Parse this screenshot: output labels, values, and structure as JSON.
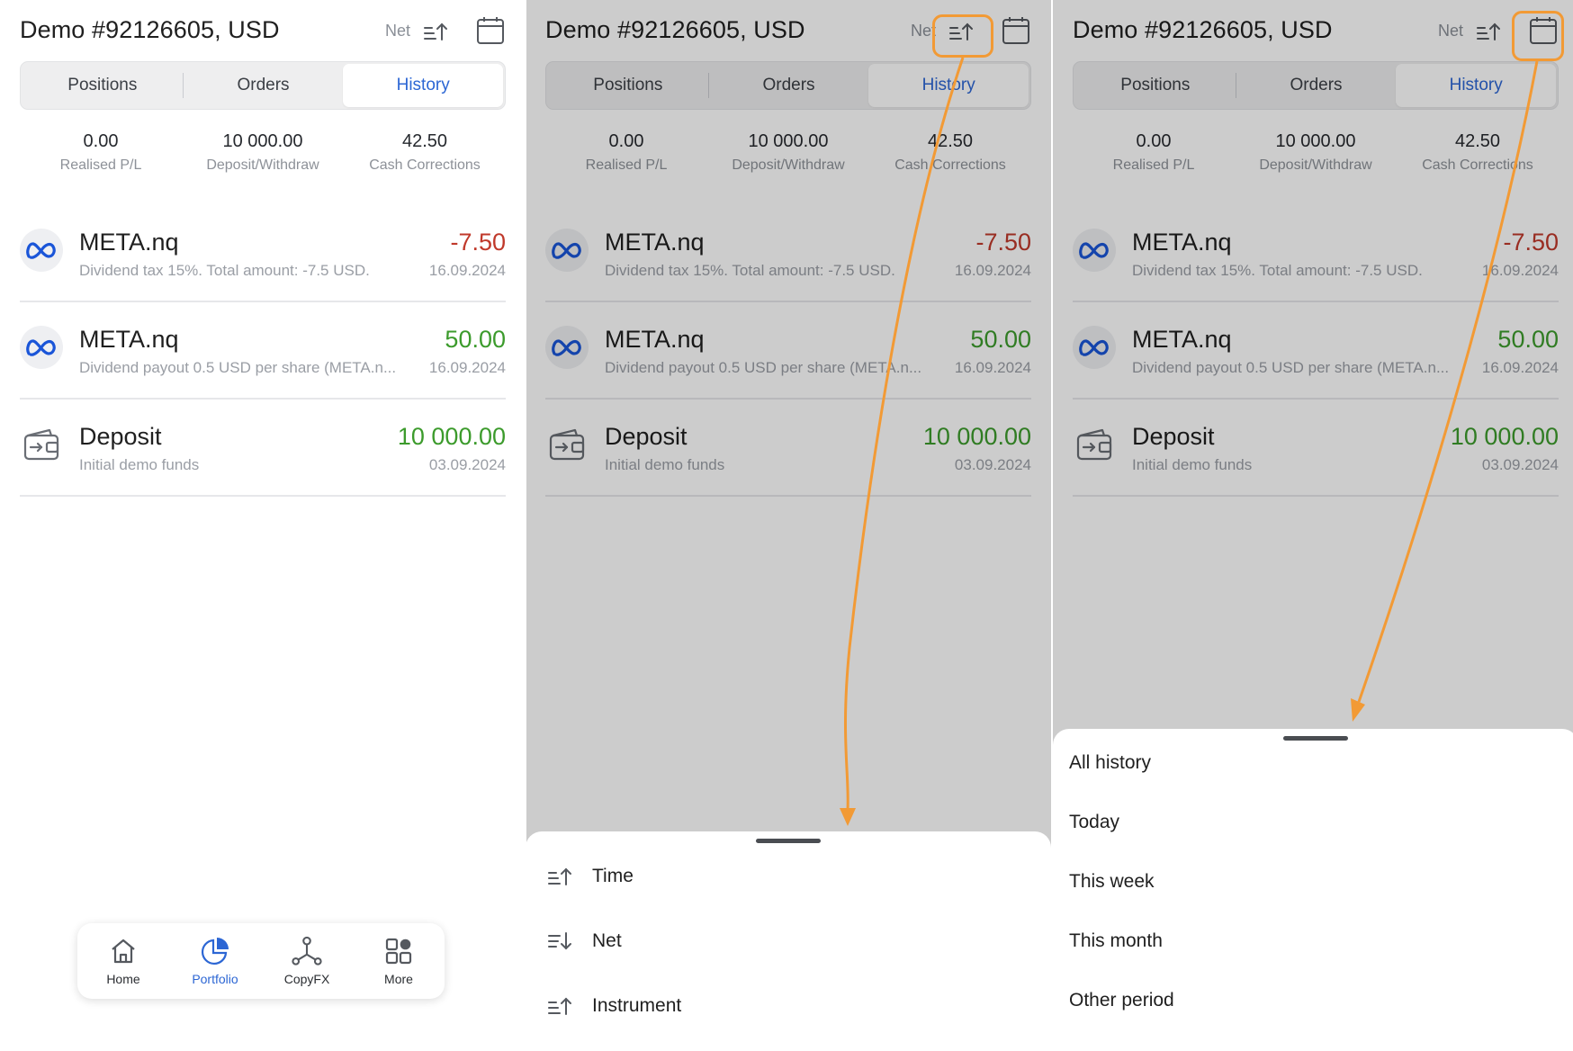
{
  "panels": [
    {
      "title": "Demo #92126605, USD",
      "net_label": "Net",
      "tabs": [
        "Positions",
        "Orders",
        "History"
      ],
      "summary": [
        {
          "value": "0.00",
          "label": "Realised P/L"
        },
        {
          "value": "10 000.00",
          "label": "Deposit/Withdraw"
        },
        {
          "value": "42.50",
          "label": "Cash Corrections"
        }
      ],
      "rows": [
        {
          "icon": "meta-logo-icon",
          "name": "META.nq",
          "desc": "Dividend tax 15%. Total amount: -7.5 USD.",
          "amount": "-7.50",
          "date": "16.09.2024"
        },
        {
          "icon": "meta-logo-icon",
          "name": "META.nq",
          "desc": "Dividend payout 0.5 USD per share (META.n...",
          "amount": "50.00",
          "date": "16.09.2024"
        },
        {
          "icon": "wallet-transfer-icon",
          "name": "Deposit",
          "desc": "Initial demo funds",
          "amount": "10 000.00",
          "date": "03.09.2024"
        }
      ]
    }
  ],
  "bottom_nav": [
    {
      "label": "Home",
      "icon": "home-icon"
    },
    {
      "label": "Portfolio",
      "icon": "pie-chart-icon",
      "active": true
    },
    {
      "label": "CopyFX",
      "icon": "network-nodes-icon"
    },
    {
      "label": "More",
      "icon": "grid-icon"
    }
  ],
  "sort_sheet": {
    "items": [
      {
        "label": "Time",
        "icon": "sort-ascending-icon"
      },
      {
        "label": "Net",
        "icon": "sort-descending-icon"
      },
      {
        "label": "Instrument",
        "icon": "sort-ascending-icon"
      }
    ]
  },
  "period_sheet": {
    "items": [
      "All history",
      "Today",
      "This week",
      "This month",
      "Other period"
    ]
  },
  "colors": {
    "accent": "#2c66d4",
    "negative": "#c0392b",
    "positive": "#3c9b2c",
    "highlight": "#f29a35"
  }
}
